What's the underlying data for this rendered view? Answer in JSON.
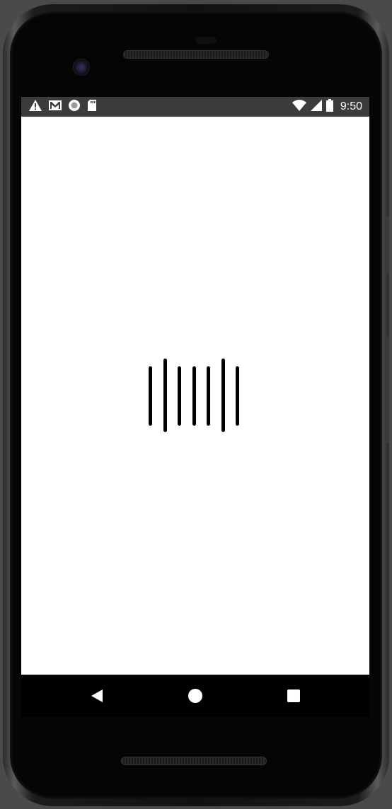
{
  "status_bar": {
    "time": "9:50",
    "left_icons": [
      "warning-icon",
      "gmail-icon",
      "record-icon",
      "sd-card-icon"
    ],
    "right_icons": [
      "wifi-icon",
      "cell-signal-icon",
      "battery-icon"
    ]
  },
  "screen": {
    "background": "#ffffff",
    "loading_indicator": {
      "icon": "barcode-loading-icon",
      "bar_count": 7
    }
  },
  "nav_bar": {
    "buttons": [
      "back-icon",
      "home-icon",
      "recents-icon"
    ]
  },
  "colors": {
    "status_bar_bg": "#3c3c3c",
    "nav_bar_bg": "#000000",
    "device_bezel": "#050505"
  }
}
